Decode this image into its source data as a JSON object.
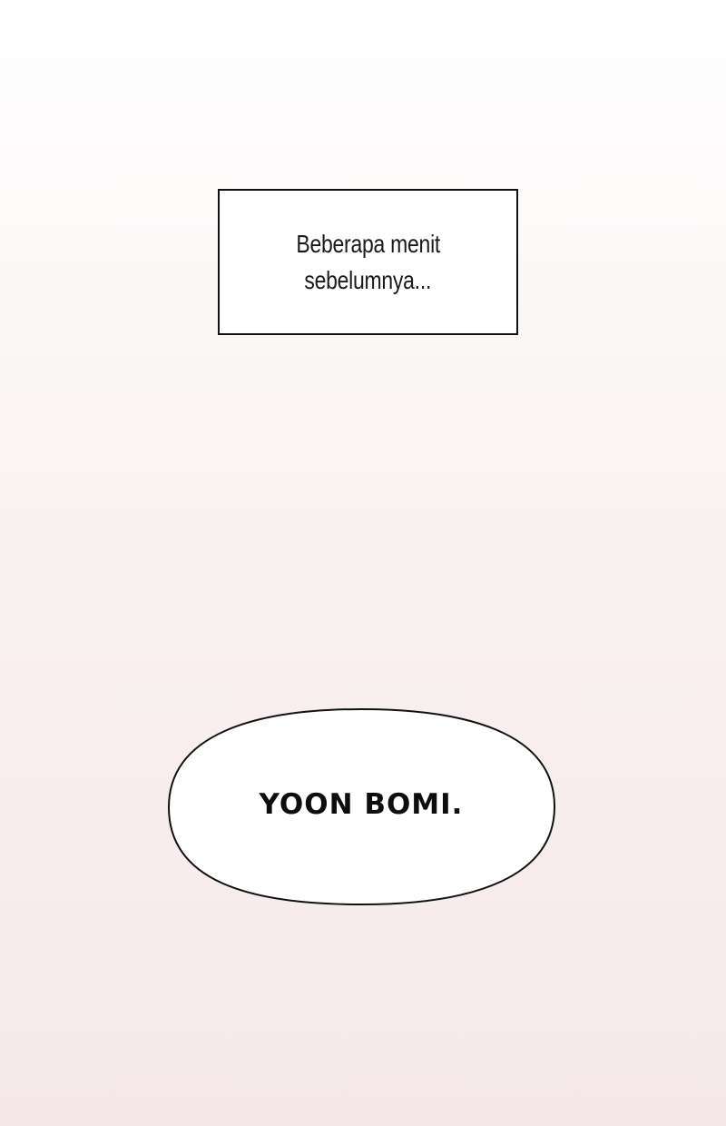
{
  "caption": {
    "lines": [
      "Beberapa menit",
      "sebelumnya..."
    ]
  },
  "speech_bubble": {
    "text": "YOON BOMI."
  }
}
